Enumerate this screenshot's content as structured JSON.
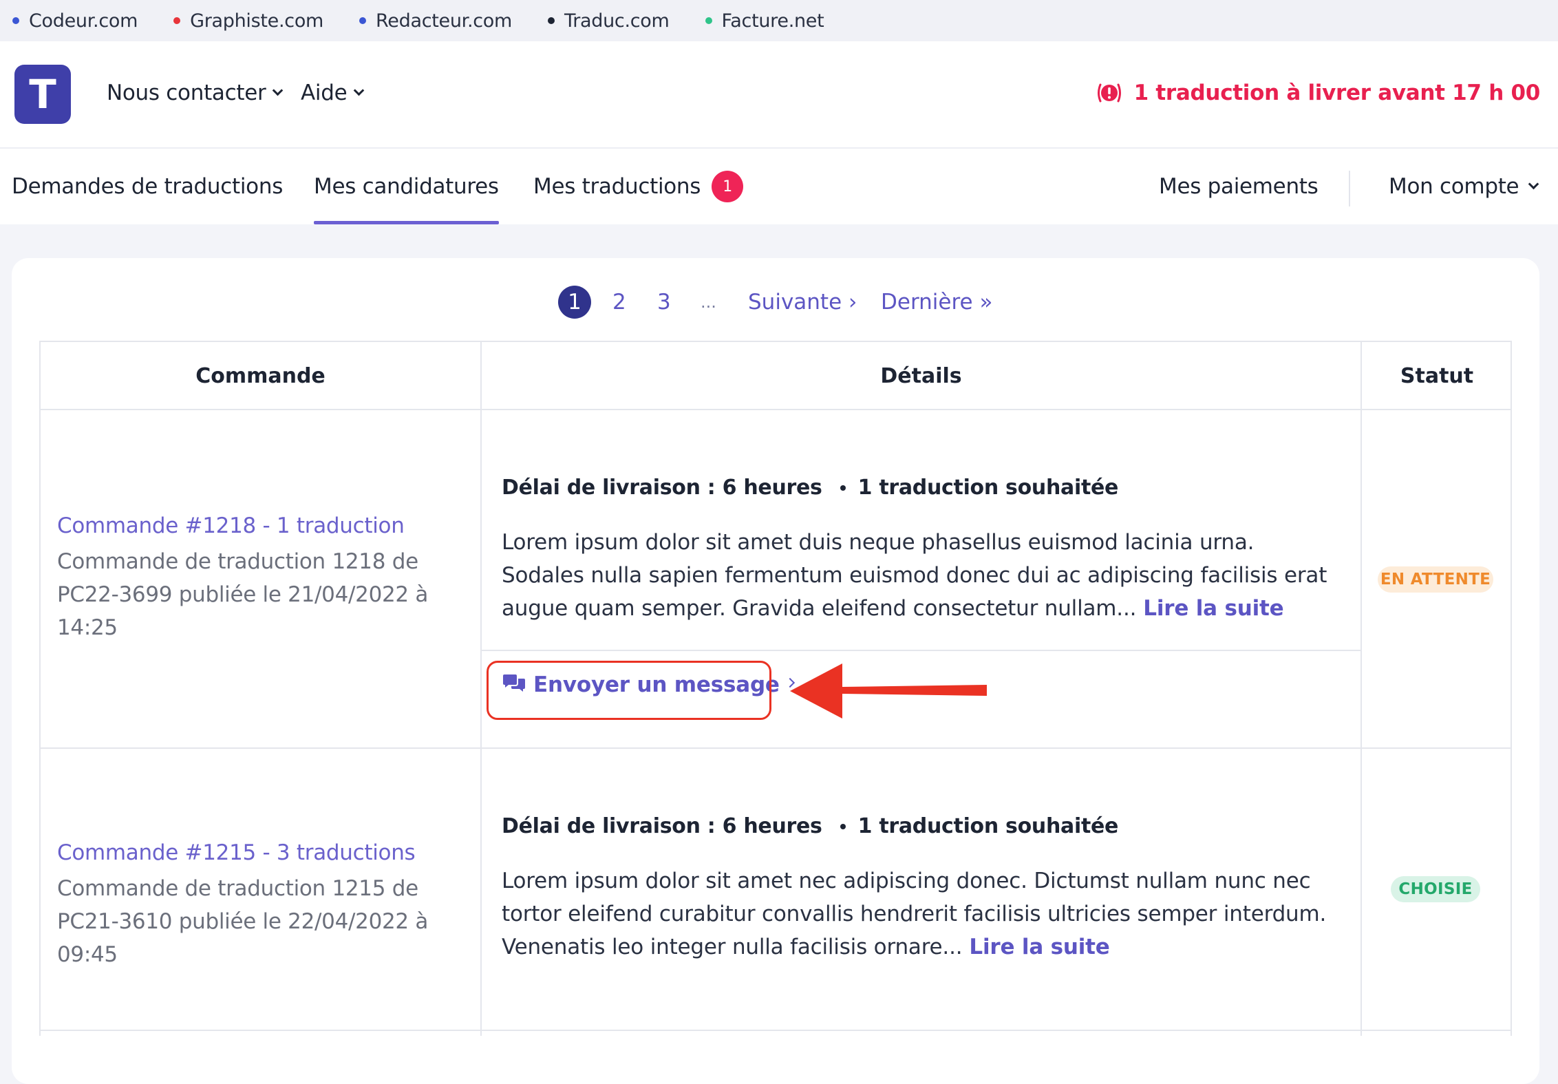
{
  "network": [
    {
      "label": "Codeur.com",
      "color": "#3a56d4"
    },
    {
      "label": "Graphiste.com",
      "color": "#e8353a"
    },
    {
      "label": "Redacteur.com",
      "color": "#3a56d4"
    },
    {
      "label": "Traduc.com",
      "color": "#1d2433"
    },
    {
      "label": "Facture.net",
      "color": "#2fc48a"
    }
  ],
  "header": {
    "logo_letter": "T",
    "nav_contact": "Nous contacter",
    "nav_help": "Aide",
    "alert_text": "1 traduction à livrer avant 17 h 00"
  },
  "tabs": {
    "requests": "Demandes de traductions",
    "applications": "Mes candidatures",
    "translations": "Mes traductions",
    "translations_badge": "1",
    "payments": "Mes paiements",
    "account": "Mon compte"
  },
  "pagination": {
    "current": "1",
    "page2": "2",
    "page3": "3",
    "ellipsis": "...",
    "next": "Suivante ›",
    "last": "Dernière »"
  },
  "table": {
    "headers": {
      "order": "Commande",
      "details": "Détails",
      "status": "Statut"
    },
    "rows": [
      {
        "order_title": "Commande #1218 - 1 traduction",
        "order_desc": "Commande de traduction 1218 de PC22-3699 publiée le 21/04/2022 à 14:25",
        "delay": "Délai de livraison : 6 heures",
        "wanted": "1 traduction souhaitée",
        "text": "Lorem ipsum dolor sit amet duis neque phasellus euismod lacinia urna. Sodales nulla sapien fermentum euismod donec dui ac adipiscing facilisis erat augue quam semper. Gravida eleifend consectetur nullam...",
        "read_more": "Lire la suite",
        "message_button": "Envoyer un message",
        "status": "EN ATTENTE"
      },
      {
        "order_title": "Commande #1215 - 3 traductions",
        "order_desc": "Commande de traduction 1215 de PC21-3610 publiée le 22/04/2022 à 09:45",
        "delay": "Délai de livraison : 6 heures",
        "wanted": "1 traduction souhaitée",
        "text": "Lorem ipsum dolor sit amet nec adipiscing donec. Dictumst nullam nunc nec tortor eleifend curabitur convallis hendrerit facilisis ultricies semper interdum. Venenatis leo integer nulla facilisis ornare...",
        "read_more": "Lire la suite",
        "status": "CHOISIE"
      }
    ]
  },
  "colors": {
    "accent": "#5c55c3",
    "alert": "#e8204f",
    "annotation": "#ea3223"
  }
}
